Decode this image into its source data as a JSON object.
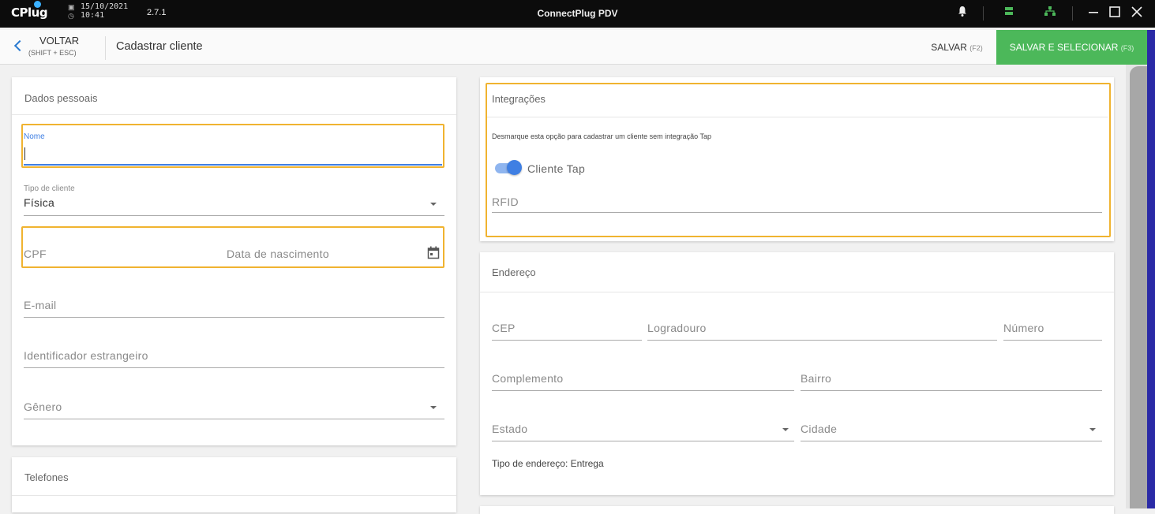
{
  "titlebar": {
    "logo": "CPlug",
    "date": "15/10/2021",
    "time": "10:41",
    "version": "2.7.1",
    "app_title": "ConnectPlug PDV",
    "icons": [
      "bell-icon",
      "server-icon",
      "network-icon",
      "minimize-icon",
      "maximize-icon",
      "close-icon"
    ],
    "accent": "#4cb85a"
  },
  "toolbar": {
    "back_label": "VOLTAR",
    "back_hint": "(SHIFT + ESC)",
    "page_title": "Cadastrar cliente",
    "save_label": "SALVAR",
    "save_hint": "(F2)",
    "save_select_label": "SALVAR E SELECIONAR",
    "save_select_hint": "(F3)"
  },
  "personal": {
    "title": "Dados pessoais",
    "name_label": "Nome",
    "client_type_label": "Tipo de cliente",
    "client_type_value": "Física",
    "cpf_label": "CPF",
    "birth_label": "Data de nascimento",
    "email_label": "E-mail",
    "foreign_id_label": "Identificador estrangeiro",
    "gender_label": "Gênero"
  },
  "phones": {
    "title": "Telefones"
  },
  "integrations": {
    "title": "Integrações",
    "hint": "Desmarque esta opção para cadastrar um cliente sem integração Tap",
    "toggle_label": "Cliente Tap",
    "toggle_on": true,
    "rfid_label": "RFID"
  },
  "address": {
    "title": "Endereço",
    "cep_label": "CEP",
    "street_label": "Logradouro",
    "number_label": "Número",
    "complement_label": "Complemento",
    "district_label": "Bairro",
    "state_label": "Estado",
    "city_label": "Cidade",
    "type_text": "Tipo de endereço: Entrega"
  },
  "colors": {
    "highlight": "#f0b330",
    "primary": "#3f7fe3",
    "success": "#4cb85a"
  }
}
